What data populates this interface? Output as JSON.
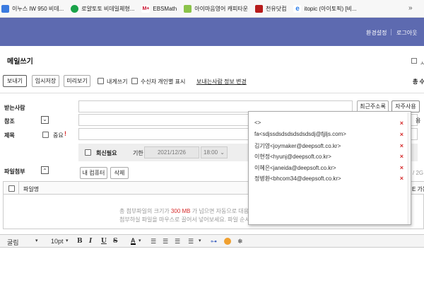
{
  "bookmarks": [
    {
      "label": "이누스 IW 950 비데...",
      "color": "#3b7be0",
      "icon": "bookmark-favicon"
    },
    {
      "label": "로얄토토 비데일체형...",
      "color": "#1aa34a",
      "icon": "bookmark-favicon"
    },
    {
      "label": "EBSMath",
      "color": "#c8102e",
      "icon": "ebs-favicon",
      "icon_text": "M+"
    },
    {
      "label": "아이마음영어 캐피타운",
      "color": "#8bc34a",
      "icon": "bookmark-favicon"
    },
    {
      "label": "천유닷컴",
      "color": "#b71c1c",
      "icon": "bookmark-favicon"
    },
    {
      "label": "itopic (아이토픽) [비...",
      "color": "#2b7de9",
      "icon": "ie-favicon"
    }
  ],
  "header": {
    "settings": "환경설정",
    "logout": "로그아웃"
  },
  "page": {
    "title": "메일쓰기",
    "right_fragment": "총 수",
    "right_top_fragment": "ㅅ"
  },
  "toolbar": {
    "send": "보내기",
    "draft": "임시저장",
    "preview": "미리보기",
    "to_self": "내게쓰기",
    "individual": "수신자 개인별 표시",
    "sender_info": "보내는사람 정보 변경"
  },
  "form": {
    "to_label": "받는사람",
    "cc_label": "참조",
    "subject_label": "제목",
    "important": "중요",
    "recent_addr": "최근주소록",
    "frequent": "자주사용",
    "cc_right_fragment": "용",
    "reply_needed": "회신필요",
    "deadline": "기한",
    "date": "2021/12/26",
    "time": "18:00"
  },
  "attach": {
    "label": "파일첨부",
    "my_computer": "내 컴퓨터",
    "delete": "삭제",
    "size_fragment": "/ 2G M",
    "col_filename": "파일명",
    "col_right_fragment": "E 가능",
    "note1_pre": "총 첨부파일의 크기가",
    "note1_size": "300 MB",
    "note1_post": "가 넘으면 자동으로 대용",
    "note2": "첨부하실 파일을 마우스로 끌어서 넣어보세요. 파일 순서"
  },
  "dropdown": {
    "items": [
      "<>",
      "fa<sdjssdsdsdsdsdsdsdj@fjjljs.com>",
      "김기영<joymaker@deepsoft.co.kr>",
      "이현정<hyunj@deepsoft.co.kr>",
      "이혜은<janeida@deepsoft.co.kr>",
      "정병환<bhcom34@deepsoft.co.kr>"
    ],
    "remove_glyph": "×"
  },
  "editor": {
    "font": "굴림",
    "size": "10pt",
    "bold": "B",
    "italic": "I",
    "underline": "U",
    "strike": "S",
    "font_color": "A"
  },
  "colors": {
    "header_bg": "#5d6ab0",
    "accent_red": "#d62b2b",
    "link": "#222222"
  }
}
